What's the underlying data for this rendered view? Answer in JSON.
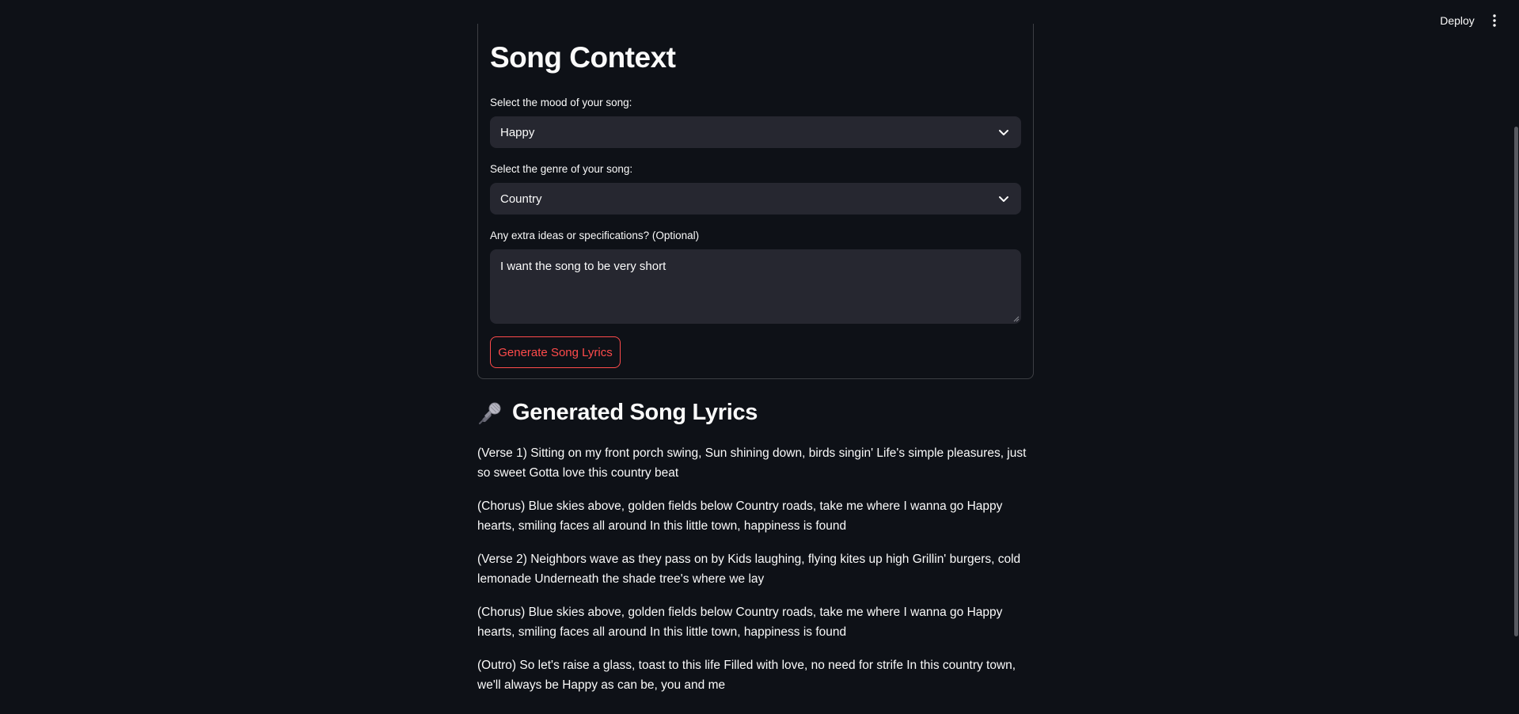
{
  "header": {
    "deploy_label": "Deploy",
    "menu_icon": "vertical-ellipsis-icon"
  },
  "form": {
    "title": "Song Context",
    "mood": {
      "label": "Select the mood of your song:",
      "value": "Happy"
    },
    "genre": {
      "label": "Select the genre of your song:",
      "value": "Country"
    },
    "extra": {
      "label": "Any extra ideas or specifications? (Optional)",
      "value": "I want the song to be very short"
    },
    "submit_label": "Generate Song Lyrics"
  },
  "lyrics": {
    "icon": "microphone-icon",
    "title": "Generated Song Lyrics",
    "stanzas": [
      "(Verse 1) Sitting on my front porch swing, Sun shining down, birds singin' Life's simple pleasures, just so sweet Gotta love this country beat",
      "(Chorus) Blue skies above, golden fields below Country roads, take me where I wanna go Happy hearts, smiling faces all around In this little town, happiness is found",
      "(Verse 2) Neighbors wave as they pass on by Kids laughing, flying kites up high Grillin' burgers, cold lemonade Underneath the shade tree's where we lay",
      "(Chorus) Blue skies above, golden fields below Country roads, take me where I wanna go Happy hearts, smiling faces all around In this little town, happiness is found",
      "(Outro) So let's raise a glass, toast to this life Filled with love, no need for strife In this country town, we'll always be Happy as can be, you and me"
    ]
  },
  "colors": {
    "background": "#0e1117",
    "input_bg": "#262730",
    "accent": "#ff4b4b",
    "text": "#fafafa"
  }
}
